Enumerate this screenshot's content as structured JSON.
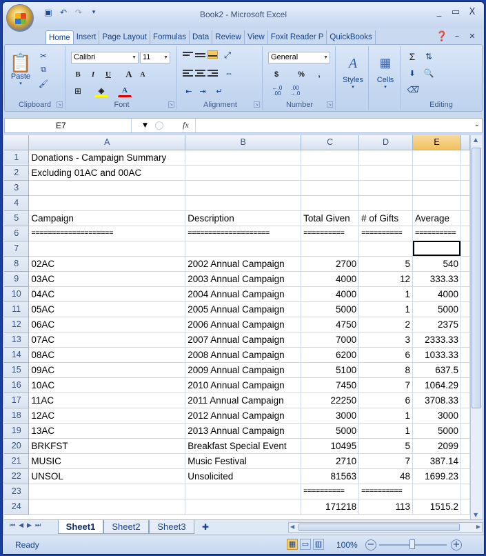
{
  "window": {
    "title": "Book2 - Microsoft Excel",
    "minimize": "_",
    "restore": "▭",
    "close": "X"
  },
  "tabs": [
    "Home",
    "Insert",
    "Page Layout",
    "Formulas",
    "Data",
    "Review",
    "View",
    "Foxit Reader P",
    "QuickBooks"
  ],
  "active_tab": "Home",
  "ribbon": {
    "clipboard": {
      "label": "Clipboard",
      "paste": "Paste"
    },
    "font": {
      "label": "Font",
      "name": "Calibri",
      "size": "11",
      "bold": "B",
      "italic": "I",
      "underline": "U",
      "grow": "A",
      "shrink": "A"
    },
    "alignment": {
      "label": "Alignment"
    },
    "number": {
      "label": "Number",
      "format": "General",
      "currency": "$",
      "percent": "%",
      "comma": ","
    },
    "styles": {
      "label": "Styles"
    },
    "cells": {
      "label": "Cells"
    },
    "editing": {
      "label": "Editing",
      "sum": "Σ"
    }
  },
  "formula_bar": {
    "name_box": "E7",
    "fx": "fx",
    "formula": ""
  },
  "columns": [
    "A",
    "B",
    "C",
    "D",
    "E"
  ],
  "selected_column": "E",
  "active_cell": "E7",
  "rows": [
    {
      "n": "1",
      "a": "Donations - Campaign Summary",
      "b": "",
      "c": "",
      "d": "",
      "e": ""
    },
    {
      "n": "2",
      "a": "Excluding 01AC and 00AC",
      "b": "",
      "c": "",
      "d": "",
      "e": ""
    },
    {
      "n": "3",
      "a": "",
      "b": "",
      "c": "",
      "d": "",
      "e": ""
    },
    {
      "n": "4",
      "a": "",
      "b": "",
      "c": "",
      "d": "",
      "e": ""
    },
    {
      "n": "5",
      "a": "Campaign",
      "b": "Description",
      "c": "Total Given",
      "d": "# of Gifts",
      "e": "Average"
    },
    {
      "n": "6",
      "a": "====================",
      "b": "====================",
      "c": "==========",
      "d": "==========",
      "e": "=========="
    },
    {
      "n": "7",
      "a": "",
      "b": "",
      "c": "",
      "d": "",
      "e": ""
    },
    {
      "n": "8",
      "a": "02AC",
      "b": "2002 Annual Campaign",
      "c": "2700",
      "d": "5",
      "e": "540"
    },
    {
      "n": "9",
      "a": "03AC",
      "b": "2003 Annual Campaign",
      "c": "4000",
      "d": "12",
      "e": "333.33"
    },
    {
      "n": "10",
      "a": "04AC",
      "b": "2004 Annual Campaign",
      "c": "4000",
      "d": "1",
      "e": "4000"
    },
    {
      "n": "11",
      "a": "05AC",
      "b": "2005 Annual Campaign",
      "c": "5000",
      "d": "1",
      "e": "5000"
    },
    {
      "n": "12",
      "a": "06AC",
      "b": "2006 Annual Campaign",
      "c": "4750",
      "d": "2",
      "e": "2375"
    },
    {
      "n": "13",
      "a": "07AC",
      "b": "2007 Annual Campaign",
      "c": "7000",
      "d": "3",
      "e": "2333.33"
    },
    {
      "n": "14",
      "a": "08AC",
      "b": "2008 Annual Campaign",
      "c": "6200",
      "d": "6",
      "e": "1033.33"
    },
    {
      "n": "15",
      "a": "09AC",
      "b": "2009 Annual Campaign",
      "c": "5100",
      "d": "8",
      "e": "637.5"
    },
    {
      "n": "16",
      "a": "10AC",
      "b": "2010 Annual Campaign",
      "c": "7450",
      "d": "7",
      "e": "1064.29"
    },
    {
      "n": "17",
      "a": "11AC",
      "b": "2011 Annual Campaign",
      "c": "22250",
      "d": "6",
      "e": "3708.33"
    },
    {
      "n": "18",
      "a": "12AC",
      "b": "2012 Annual Campaign",
      "c": "3000",
      "d": "1",
      "e": "3000"
    },
    {
      "n": "19",
      "a": "13AC",
      "b": "2013 Annual Campaign",
      "c": "5000",
      "d": "1",
      "e": "5000"
    },
    {
      "n": "20",
      "a": "BRKFST",
      "b": "Breakfast Special Event",
      "c": "10495",
      "d": "5",
      "e": "2099"
    },
    {
      "n": "21",
      "a": "MUSIC",
      "b": "Music Festival",
      "c": "2710",
      "d": "7",
      "e": "387.14"
    },
    {
      "n": "22",
      "a": "UNSOL",
      "b": "Unsolicited",
      "c": "81563",
      "d": "48",
      "e": "1699.23"
    },
    {
      "n": "23",
      "a": "",
      "b": "",
      "c": "==========",
      "d": "==========",
      "e": ""
    },
    {
      "n": "24",
      "a": "",
      "b": "",
      "c": "171218",
      "d": "113",
      "e": "1515.2"
    }
  ],
  "sheets": [
    "Sheet1",
    "Sheet2",
    "Sheet3"
  ],
  "active_sheet": "Sheet1",
  "status": {
    "ready": "Ready",
    "zoom": "100%"
  }
}
